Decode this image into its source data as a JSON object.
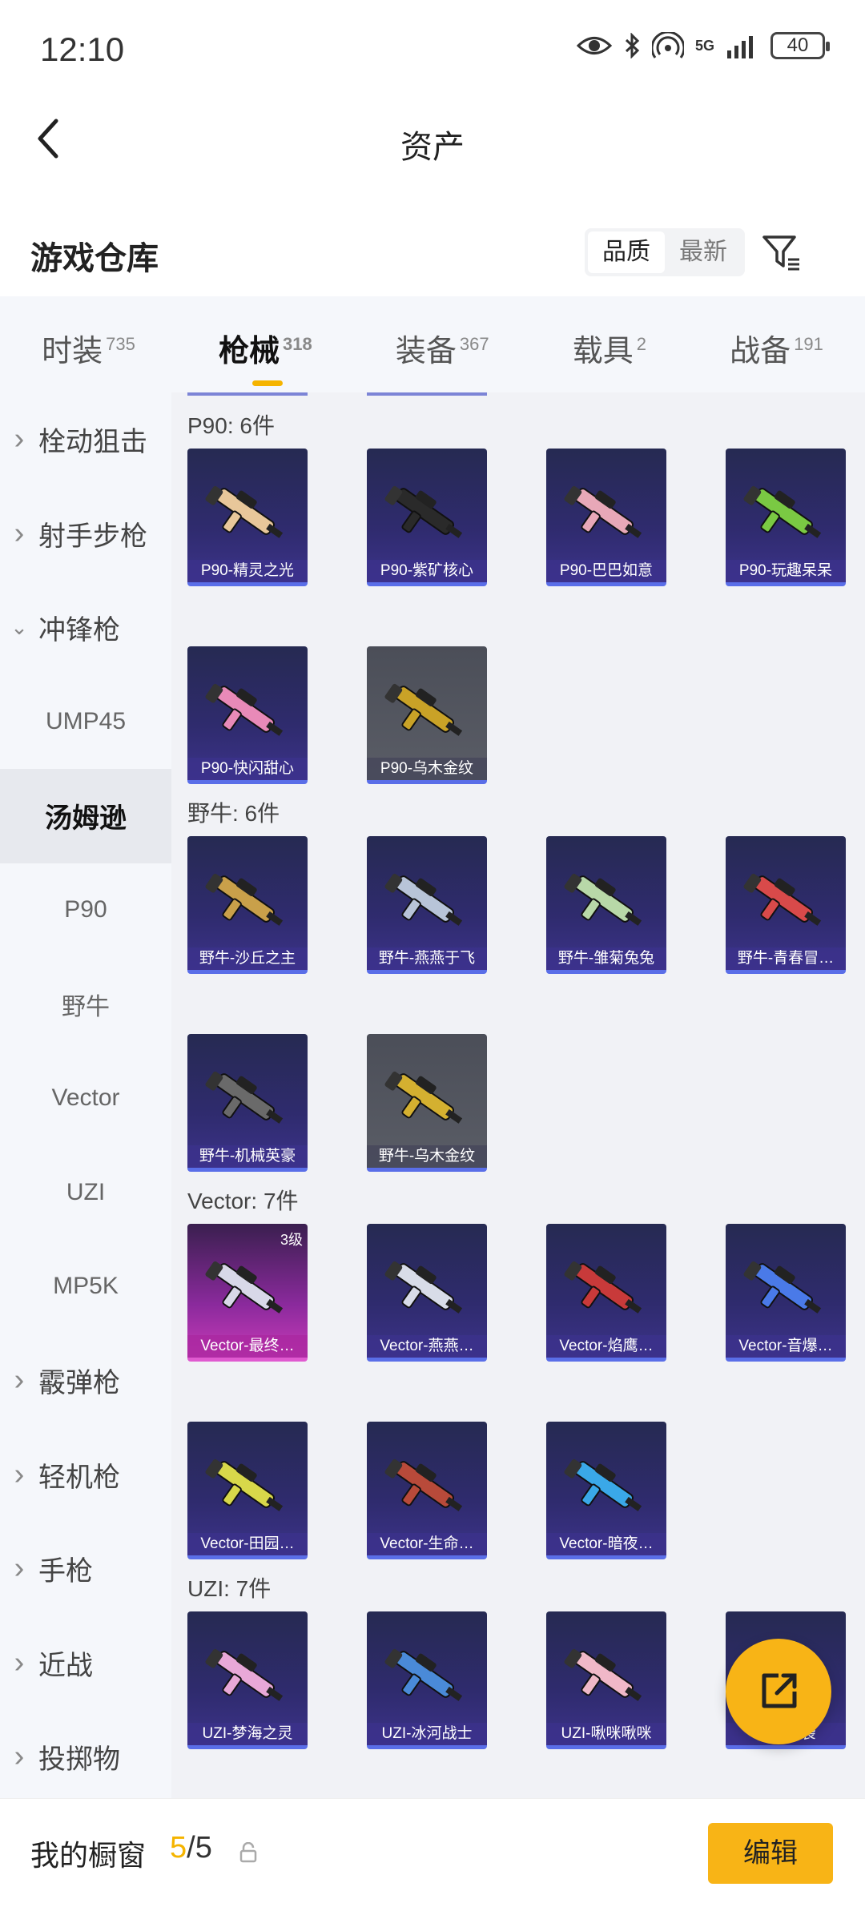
{
  "status": {
    "time": "12:10",
    "signal_label": "5G",
    "battery": "40"
  },
  "header": {
    "title": "资产"
  },
  "warehouse": {
    "title": "游戏仓库",
    "sort_options": [
      "品质",
      "最新"
    ],
    "active_sort": "品质"
  },
  "tabs": [
    {
      "label": "时装",
      "count": "735"
    },
    {
      "label": "枪械",
      "count": "318"
    },
    {
      "label": "装备",
      "count": "367"
    },
    {
      "label": "载具",
      "count": "2"
    },
    {
      "label": "战备",
      "count": "191"
    }
  ],
  "sidebar": [
    {
      "label": "栓动狙击",
      "type": "group",
      "expanded": false
    },
    {
      "label": "射手步枪",
      "type": "group",
      "expanded": false
    },
    {
      "label": "冲锋枪",
      "type": "group",
      "expanded": true
    },
    {
      "label": "UMP45",
      "type": "sub"
    },
    {
      "label": "汤姆逊",
      "type": "sub",
      "selected": true
    },
    {
      "label": "P90",
      "type": "sub"
    },
    {
      "label": "野牛",
      "type": "sub"
    },
    {
      "label": "Vector",
      "type": "sub"
    },
    {
      "label": "UZI",
      "type": "sub"
    },
    {
      "label": "MP5K",
      "type": "sub"
    },
    {
      "label": "霰弹枪",
      "type": "group",
      "expanded": false
    },
    {
      "label": "轻机枪",
      "type": "group",
      "expanded": false
    },
    {
      "label": "手枪",
      "type": "group",
      "expanded": false
    },
    {
      "label": "近战",
      "type": "group",
      "expanded": false
    },
    {
      "label": "投掷物",
      "type": "group",
      "expanded": false
    }
  ],
  "sections": [
    {
      "title": "P90: 6件",
      "items": [
        {
          "name": "P90-精灵之光",
          "color": "#e8c79a"
        },
        {
          "name": "P90-紫矿核心",
          "color": "#2a2a2a"
        },
        {
          "name": "P90-巴巴如意",
          "color": "#e8a8b8"
        },
        {
          "name": "P90-玩趣呆呆",
          "color": "#7ac943"
        },
        {
          "name": "P90-快闪甜心",
          "color": "#e88ab8"
        },
        {
          "name": "P90-乌木金纹",
          "color": "#c9a227",
          "variant": "gray"
        }
      ]
    },
    {
      "title": "野牛: 6件",
      "items": [
        {
          "name": "野牛-沙丘之主",
          "color": "#c9a04a"
        },
        {
          "name": "野牛-燕燕于飞",
          "color": "#b8c4d8"
        },
        {
          "name": "野牛-雏菊兔兔",
          "color": "#b8d8a8"
        },
        {
          "name": "野牛-青春冒…",
          "color": "#d84a4a"
        },
        {
          "name": "野牛-机械英豪",
          "color": "#6a6a6a"
        },
        {
          "name": "野牛-乌木金纹",
          "color": "#d4b030",
          "variant": "gray"
        }
      ]
    },
    {
      "title": "Vector: 7件",
      "items": [
        {
          "name": "Vector-最终…",
          "color": "#d8d8e8",
          "variant": "pink",
          "level": "3级"
        },
        {
          "name": "Vector-燕燕…",
          "color": "#d8dce8"
        },
        {
          "name": "Vector-焰鹰…",
          "color": "#c83a3a"
        },
        {
          "name": "Vector-音爆…",
          "color": "#4a7ae8"
        },
        {
          "name": "Vector-田园…",
          "color": "#d8d84a"
        },
        {
          "name": "Vector-生命…",
          "color": "#b84a3a"
        },
        {
          "name": "Vector-暗夜…",
          "color": "#3aa8e8"
        }
      ]
    },
    {
      "title": "UZI: 7件",
      "items": [
        {
          "name": "UZI-梦海之灵",
          "color": "#e8a8d8"
        },
        {
          "name": "UZI-冰河战士",
          "color": "#4a8ad8"
        },
        {
          "name": "UZI-啾咪啾咪",
          "color": "#f0b8c8"
        },
        {
          "name": "UZI-影袭",
          "color": "#4a4a6a"
        }
      ]
    }
  ],
  "bottom": {
    "label": "我的橱窗",
    "current": "5",
    "total": "/5",
    "edit": "编辑"
  }
}
